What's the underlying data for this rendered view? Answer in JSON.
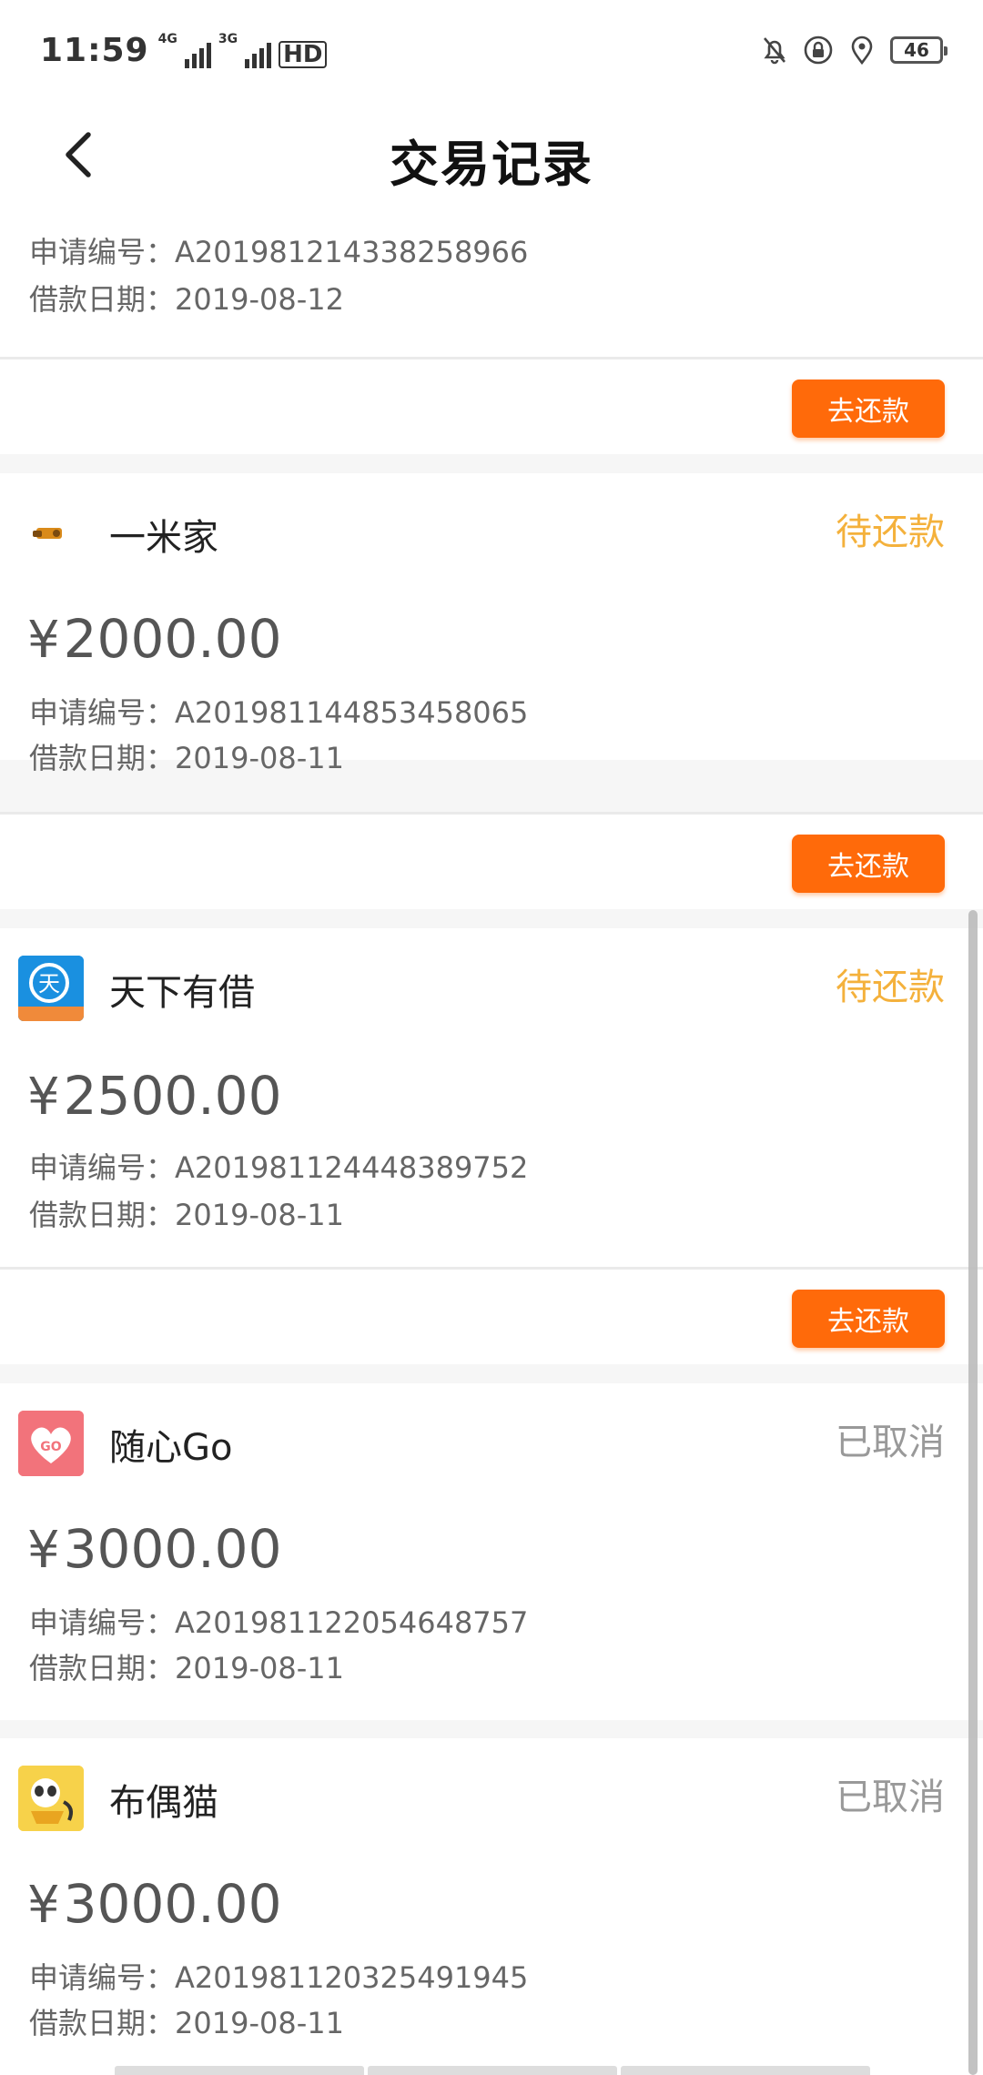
{
  "status_bar": {
    "time": "11:59",
    "net1": "4G",
    "net2": "3G",
    "hd": "HD",
    "battery": "46"
  },
  "header": {
    "title": "交易记录",
    "back_icon": "chevron-left-icon"
  },
  "labels": {
    "apply_no": "申请编号：",
    "loan_date": "借款日期：",
    "currency": "¥",
    "repay_button": "去还款"
  },
  "colors": {
    "pending": "#f4b13c",
    "cancelled": "#999999",
    "repay_button": "#ff6a0a"
  },
  "records": [
    {
      "apply_no": "A201981214338258966",
      "loan_date": "2019-08-12"
    },
    {
      "name": "一米家",
      "status": "待还款",
      "amount": "2000.00",
      "apply_no": "A201981144853458065",
      "loan_date": "2019-08-11",
      "logo": "yimijia-logo-icon"
    },
    {
      "name": "天下有借",
      "status": "待还款",
      "amount": "2500.00",
      "apply_no": "A201981124448389752",
      "loan_date": "2019-08-11",
      "logo": "tianxia-logo-icon"
    },
    {
      "name": "随心Go",
      "status": "已取消",
      "amount": "3000.00",
      "apply_no": "A201981122054648757",
      "loan_date": "2019-08-11",
      "logo": "heart-go-logo-icon"
    },
    {
      "name": "布偶猫",
      "status": "已取消",
      "amount": "3000.00",
      "apply_no": "A201981120325491945",
      "loan_date": "2019-08-11",
      "logo": "panda-cat-logo-icon"
    }
  ]
}
